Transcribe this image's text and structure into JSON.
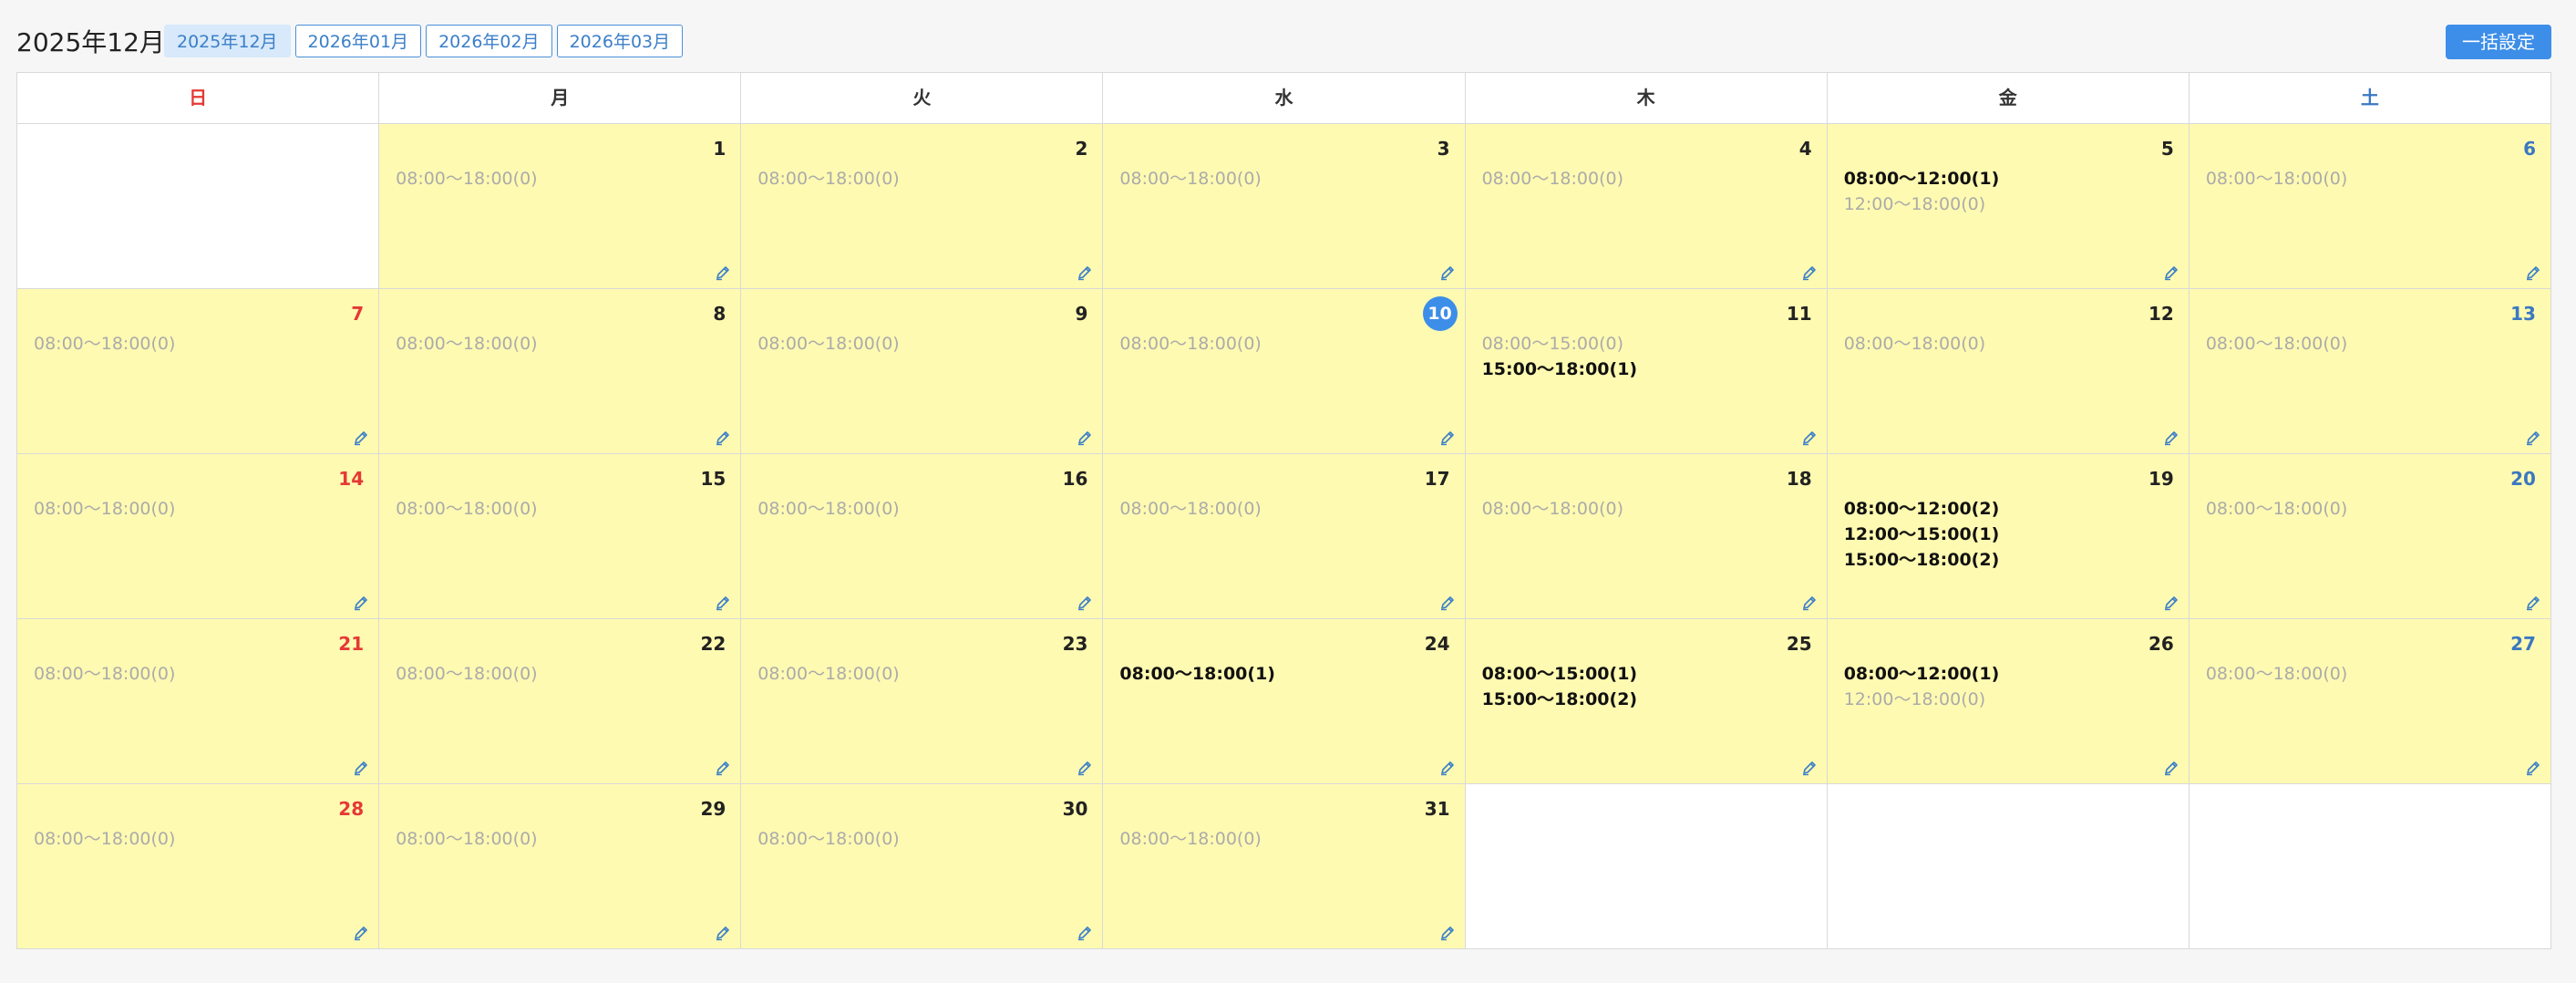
{
  "header": {
    "month_title": "2025年12月",
    "month_tabs": [
      {
        "label": "2025年12月",
        "active": true
      },
      {
        "label": "2026年01月",
        "active": false
      },
      {
        "label": "2026年02月",
        "active": false
      },
      {
        "label": "2026年03月",
        "active": false
      }
    ],
    "bulk_button_label": "一括設定"
  },
  "calendar": {
    "weekdays": [
      "日",
      "月",
      "火",
      "水",
      "木",
      "金",
      "土"
    ],
    "today": 10,
    "leading_blanks": 1,
    "trailing_blanks": 3,
    "days": [
      {
        "day": 1,
        "slots": [
          {
            "text": "08:00〜18:00(0)",
            "booked": false
          }
        ]
      },
      {
        "day": 2,
        "slots": [
          {
            "text": "08:00〜18:00(0)",
            "booked": false
          }
        ]
      },
      {
        "day": 3,
        "slots": [
          {
            "text": "08:00〜18:00(0)",
            "booked": false
          }
        ]
      },
      {
        "day": 4,
        "slots": [
          {
            "text": "08:00〜18:00(0)",
            "booked": false
          }
        ]
      },
      {
        "day": 5,
        "slots": [
          {
            "text": "08:00〜12:00(1)",
            "booked": true
          },
          {
            "text": "12:00〜18:00(0)",
            "booked": false
          }
        ]
      },
      {
        "day": 6,
        "slots": [
          {
            "text": "08:00〜18:00(0)",
            "booked": false
          }
        ]
      },
      {
        "day": 7,
        "slots": [
          {
            "text": "08:00〜18:00(0)",
            "booked": false
          }
        ]
      },
      {
        "day": 8,
        "slots": [
          {
            "text": "08:00〜18:00(0)",
            "booked": false
          }
        ]
      },
      {
        "day": 9,
        "slots": [
          {
            "text": "08:00〜18:00(0)",
            "booked": false
          }
        ]
      },
      {
        "day": 10,
        "slots": [
          {
            "text": "08:00〜18:00(0)",
            "booked": false
          }
        ]
      },
      {
        "day": 11,
        "slots": [
          {
            "text": "08:00〜15:00(0)",
            "booked": false
          },
          {
            "text": "15:00〜18:00(1)",
            "booked": true
          }
        ]
      },
      {
        "day": 12,
        "slots": [
          {
            "text": "08:00〜18:00(0)",
            "booked": false
          }
        ]
      },
      {
        "day": 13,
        "slots": [
          {
            "text": "08:00〜18:00(0)",
            "booked": false
          }
        ]
      },
      {
        "day": 14,
        "slots": [
          {
            "text": "08:00〜18:00(0)",
            "booked": false
          }
        ]
      },
      {
        "day": 15,
        "slots": [
          {
            "text": "08:00〜18:00(0)",
            "booked": false
          }
        ]
      },
      {
        "day": 16,
        "slots": [
          {
            "text": "08:00〜18:00(0)",
            "booked": false
          }
        ]
      },
      {
        "day": 17,
        "slots": [
          {
            "text": "08:00〜18:00(0)",
            "booked": false
          }
        ]
      },
      {
        "day": 18,
        "slots": [
          {
            "text": "08:00〜18:00(0)",
            "booked": false
          }
        ]
      },
      {
        "day": 19,
        "slots": [
          {
            "text": "08:00〜12:00(2)",
            "booked": true
          },
          {
            "text": "12:00〜15:00(1)",
            "booked": true
          },
          {
            "text": "15:00〜18:00(2)",
            "booked": true
          }
        ]
      },
      {
        "day": 20,
        "slots": [
          {
            "text": "08:00〜18:00(0)",
            "booked": false
          }
        ]
      },
      {
        "day": 21,
        "slots": [
          {
            "text": "08:00〜18:00(0)",
            "booked": false
          }
        ]
      },
      {
        "day": 22,
        "slots": [
          {
            "text": "08:00〜18:00(0)",
            "booked": false
          }
        ]
      },
      {
        "day": 23,
        "slots": [
          {
            "text": "08:00〜18:00(0)",
            "booked": false
          }
        ]
      },
      {
        "day": 24,
        "slots": [
          {
            "text": "08:00〜18:00(1)",
            "booked": true
          }
        ]
      },
      {
        "day": 25,
        "slots": [
          {
            "text": "08:00〜15:00(1)",
            "booked": true
          },
          {
            "text": "15:00〜18:00(2)",
            "booked": true
          }
        ]
      },
      {
        "day": 26,
        "slots": [
          {
            "text": "08:00〜12:00(1)",
            "booked": true
          },
          {
            "text": "12:00〜18:00(0)",
            "booked": false
          }
        ]
      },
      {
        "day": 27,
        "slots": [
          {
            "text": "08:00〜18:00(0)",
            "booked": false
          }
        ]
      },
      {
        "day": 28,
        "slots": [
          {
            "text": "08:00〜18:00(0)",
            "booked": false
          }
        ]
      },
      {
        "day": 29,
        "slots": [
          {
            "text": "08:00〜18:00(0)",
            "booked": false
          }
        ]
      },
      {
        "day": 30,
        "slots": [
          {
            "text": "08:00〜18:00(0)",
            "booked": false
          }
        ]
      },
      {
        "day": 31,
        "slots": [
          {
            "text": "08:00〜18:00(0)",
            "booked": false
          }
        ]
      }
    ]
  },
  "icons": {
    "edit": "pencil-icon"
  },
  "colors": {
    "accent": "#3d8ee8",
    "cell_fill": "#fffab1",
    "sunday": "#e53935",
    "saturday": "#3b78c2",
    "muted_slot": "#ababab"
  }
}
